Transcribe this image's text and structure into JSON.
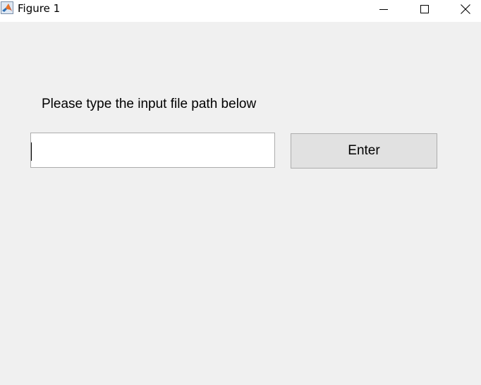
{
  "window": {
    "title": "Figure 1",
    "app_icon": "matlab-icon",
    "controls": {
      "minimize_icon": "minimize-icon",
      "maximize_icon": "maximize-icon",
      "close_icon": "close-icon"
    }
  },
  "form": {
    "prompt": "Please type the input file path below",
    "input_value": "",
    "button_label": "Enter"
  },
  "colors": {
    "background": "#f0f0f0",
    "titlebar": "#ffffff",
    "button_face": "#e1e1e1"
  }
}
